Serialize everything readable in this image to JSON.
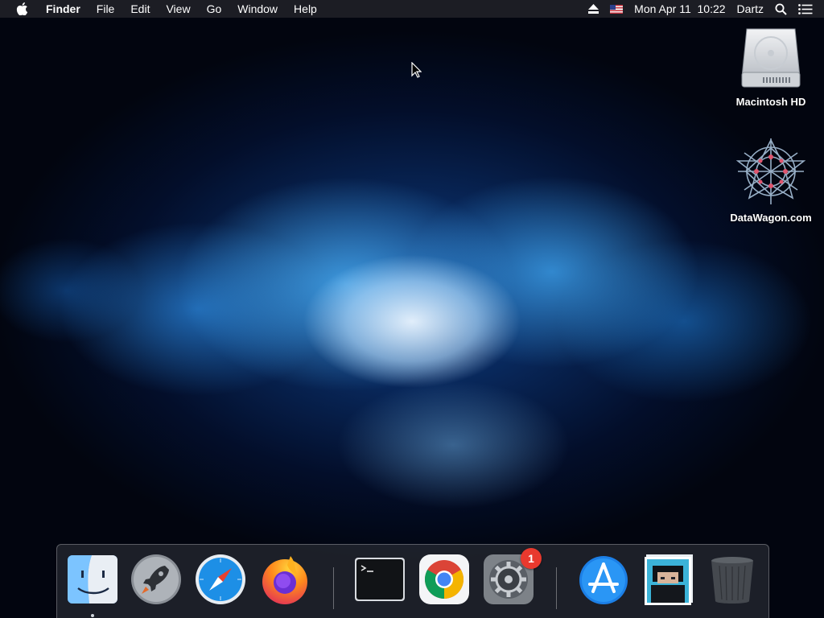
{
  "menubar": {
    "app_name": "Finder",
    "menus": [
      "File",
      "Edit",
      "View",
      "Go",
      "Window",
      "Help"
    ],
    "datetime": "Mon Apr 11  10:22",
    "user": "Dartz"
  },
  "desktop": {
    "icons": [
      {
        "label": "Macintosh HD"
      },
      {
        "label": "DataWagon.com"
      }
    ]
  },
  "dock": {
    "apps": [
      {
        "name": "Finder",
        "icon": "finder-icon",
        "running": true
      },
      {
        "name": "Launchpad",
        "icon": "launchpad-icon"
      },
      {
        "name": "Safari",
        "icon": "safari-icon"
      },
      {
        "name": "Firefox",
        "icon": "firefox-icon"
      },
      {
        "name": "Terminal",
        "icon": "terminal-icon"
      },
      {
        "name": "Google Chrome",
        "icon": "chrome-icon"
      },
      {
        "name": "System Preferences",
        "icon": "system-preferences-icon",
        "badge": "1"
      },
      {
        "name": "App Store",
        "icon": "app-store-icon"
      },
      {
        "name": "Photo Stack",
        "icon": "photo-stack-icon"
      },
      {
        "name": "Trash",
        "icon": "trash-icon"
      }
    ],
    "badge_color": "#e8392e"
  },
  "colors": {
    "menubar_bg": "#1e2026",
    "wallpaper_accent": "#46aaf0"
  }
}
